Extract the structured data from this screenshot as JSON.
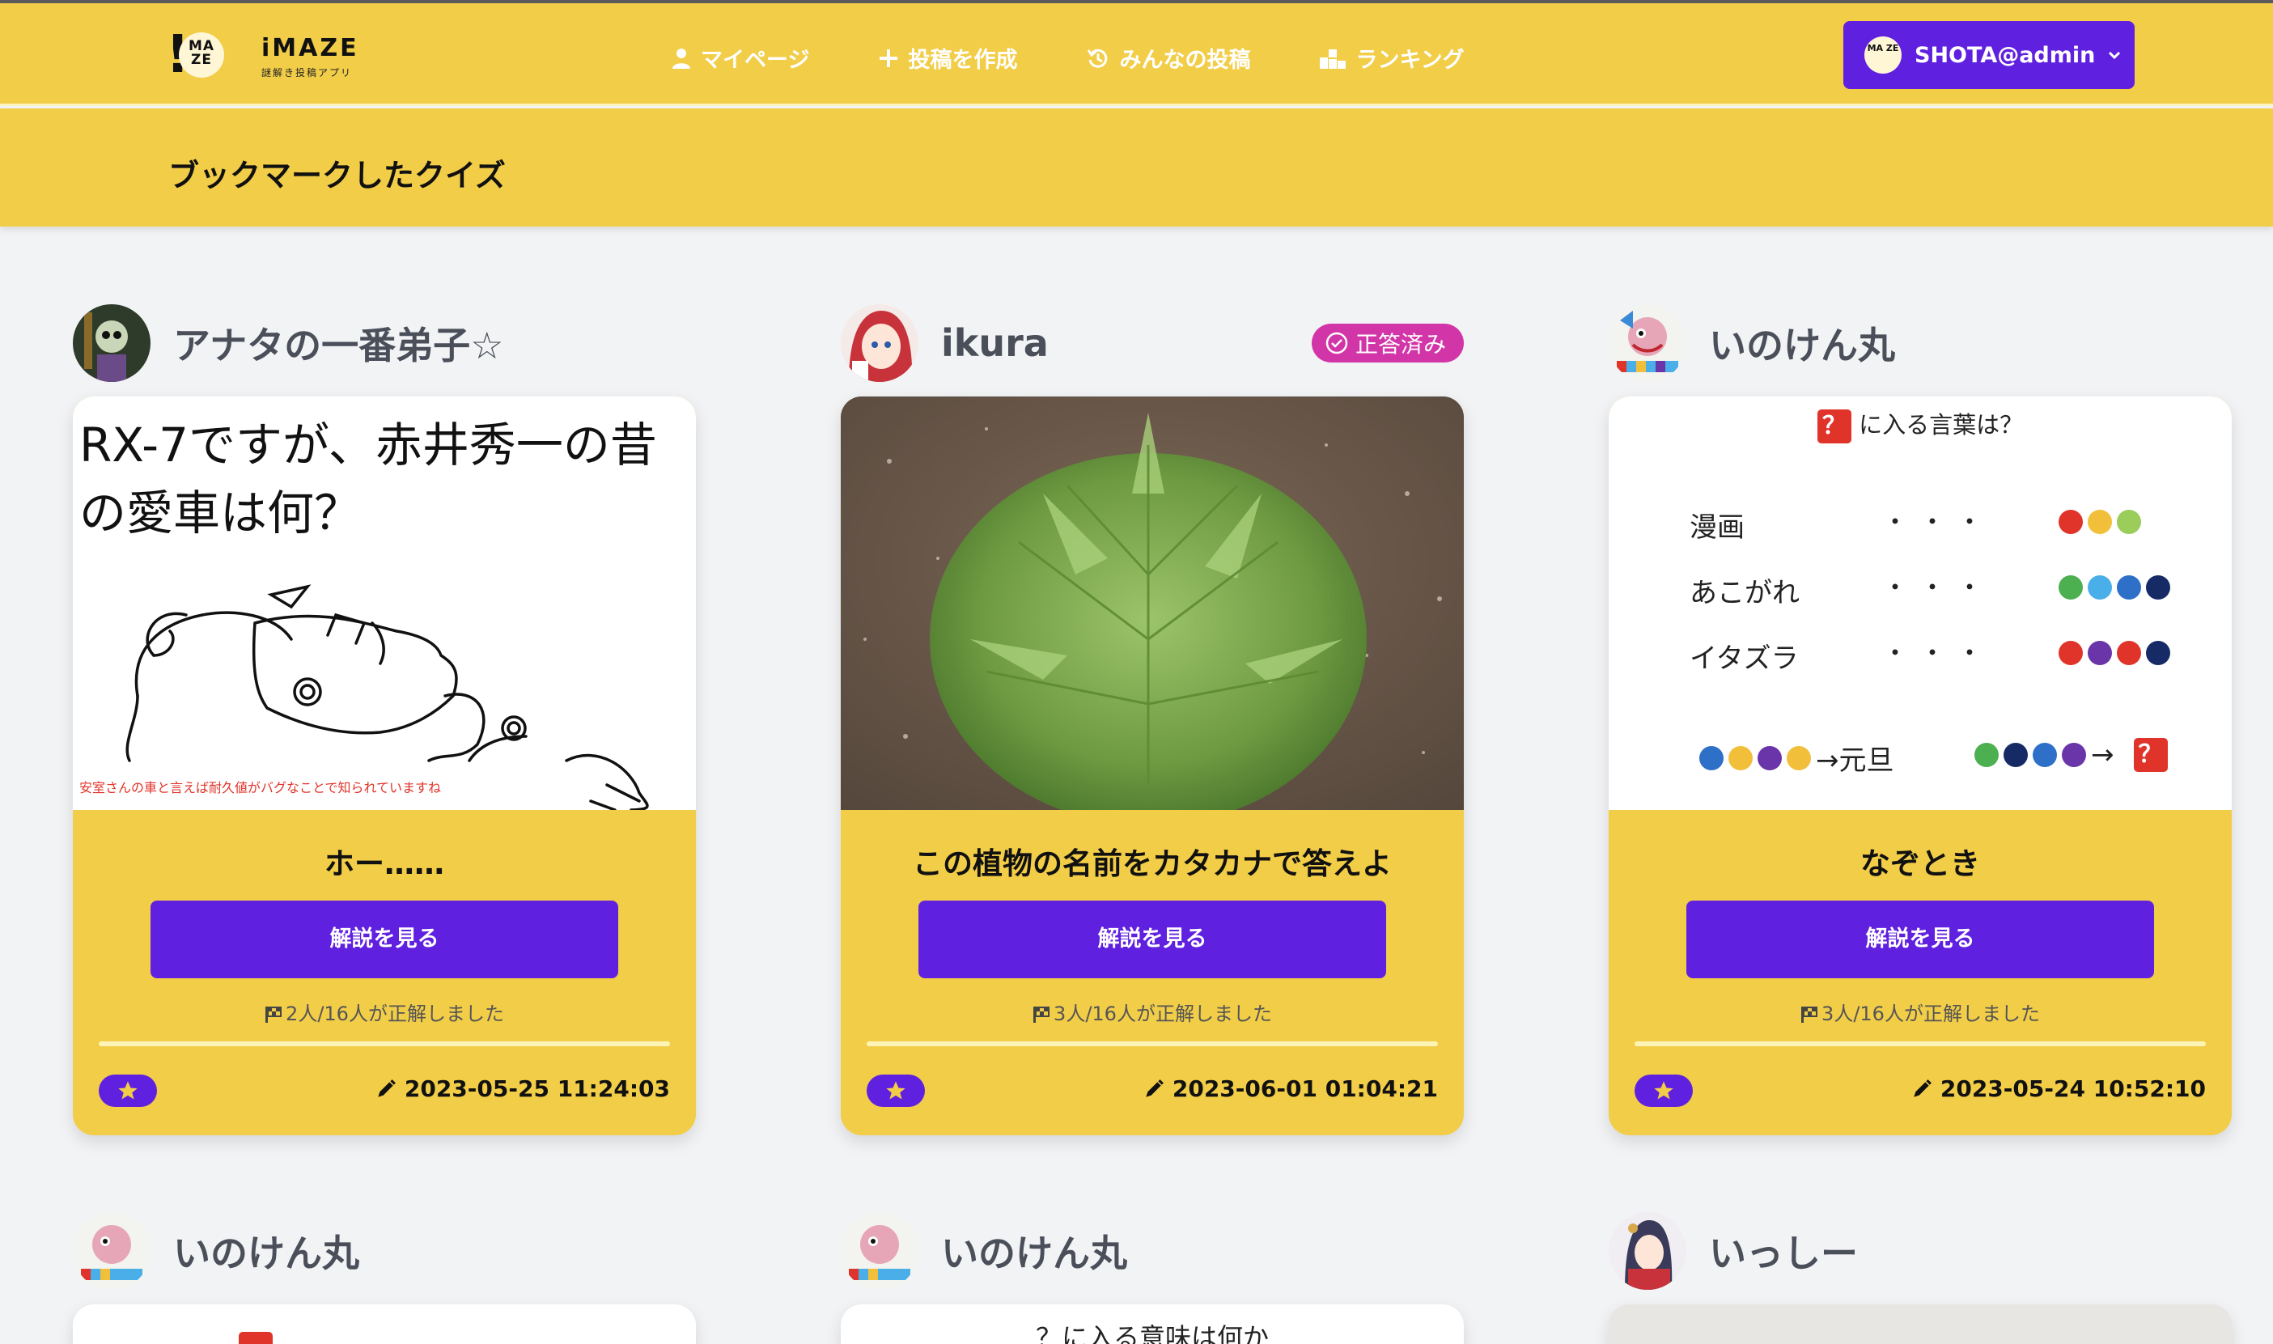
{
  "app": {
    "logo_title": "iMAZE",
    "logo_subtitle": "謎解き投稿アプリ",
    "logo_mark_top": "MA",
    "logo_mark_bottom": "ZE",
    "logo_mark_bang": "!"
  },
  "nav": {
    "items": [
      {
        "label": "マイページ",
        "icon": "user-icon"
      },
      {
        "label": "投稿を作成",
        "icon": "plus-icon"
      },
      {
        "label": "みんなの投稿",
        "icon": "history-icon"
      },
      {
        "label": "ランキング",
        "icon": "ranking-podium-icon"
      }
    ],
    "user_label": "SHOTA@admin",
    "user_avatar_text": "MA ZE"
  },
  "page": {
    "title": "ブックマークしたクイズ"
  },
  "colors": {
    "brand_yellow": "#f2cd48",
    "brand_purple": "#6020e0",
    "badge_magenta": "#d235a8",
    "accent_red": "#e0342a"
  },
  "cards": [
    {
      "author": "アナタの一番弟子☆",
      "solved_badge": "",
      "image_text": "RX-7ですが、赤井秀一の昔の愛車は何？",
      "image_note": "安室さんの車と言えば耐久値がバグなことで知られていますね",
      "title": "ホー……",
      "button": "解説を見る",
      "stat": "2人/16人が正解しました",
      "date": "2023-05-25 11:24:03"
    },
    {
      "author": "ikura",
      "solved_badge": "正答済み",
      "image_text": "",
      "image_note": "",
      "title": "この植物の名前をカタカナで答えよ",
      "button": "解説を見る",
      "stat": "3人/16人が正解しました",
      "date": "2023-06-01 01:04:21"
    },
    {
      "author": "いのけん丸",
      "solved_badge": "",
      "image_text": "",
      "image_note": "",
      "title": "なぞとき",
      "button": "解説を見る",
      "stat": "3人/16人が正解しました",
      "date": "2023-05-24 10:52:10"
    }
  ],
  "puzzle3": {
    "qmark": "？",
    "header": "に入る言葉は？",
    "rows": [
      {
        "word": "漫画",
        "dots": "・・・",
        "colors": [
          "#e0342a",
          "#f2bf3a",
          "#9acd5a"
        ]
      },
      {
        "word": "あこがれ",
        "dots": "・・・",
        "colors": [
          "#4caf50",
          "#4aaee8",
          "#2e6fc8",
          "#162a66"
        ]
      },
      {
        "word": "イタズラ",
        "dots": "・・・",
        "colors": [
          "#e0342a",
          "#6a35a8",
          "#e0342a",
          "#162a66"
        ]
      }
    ],
    "bottom_left_colors": [
      "#2e6fc8",
      "#f2bf3a",
      "#6a35a8",
      "#f2bf3a"
    ],
    "bottom_left_text": "→元旦",
    "bottom_right_colors": [
      "#4caf50",
      "#162a66",
      "#2e6fc8",
      "#6a35a8"
    ],
    "bottom_right_arrow": "→"
  },
  "next_row": {
    "authors": [
      "いのけん丸",
      "いのけん丸",
      "いっしー"
    ],
    "peek_text": "？に入る意味は何か"
  }
}
